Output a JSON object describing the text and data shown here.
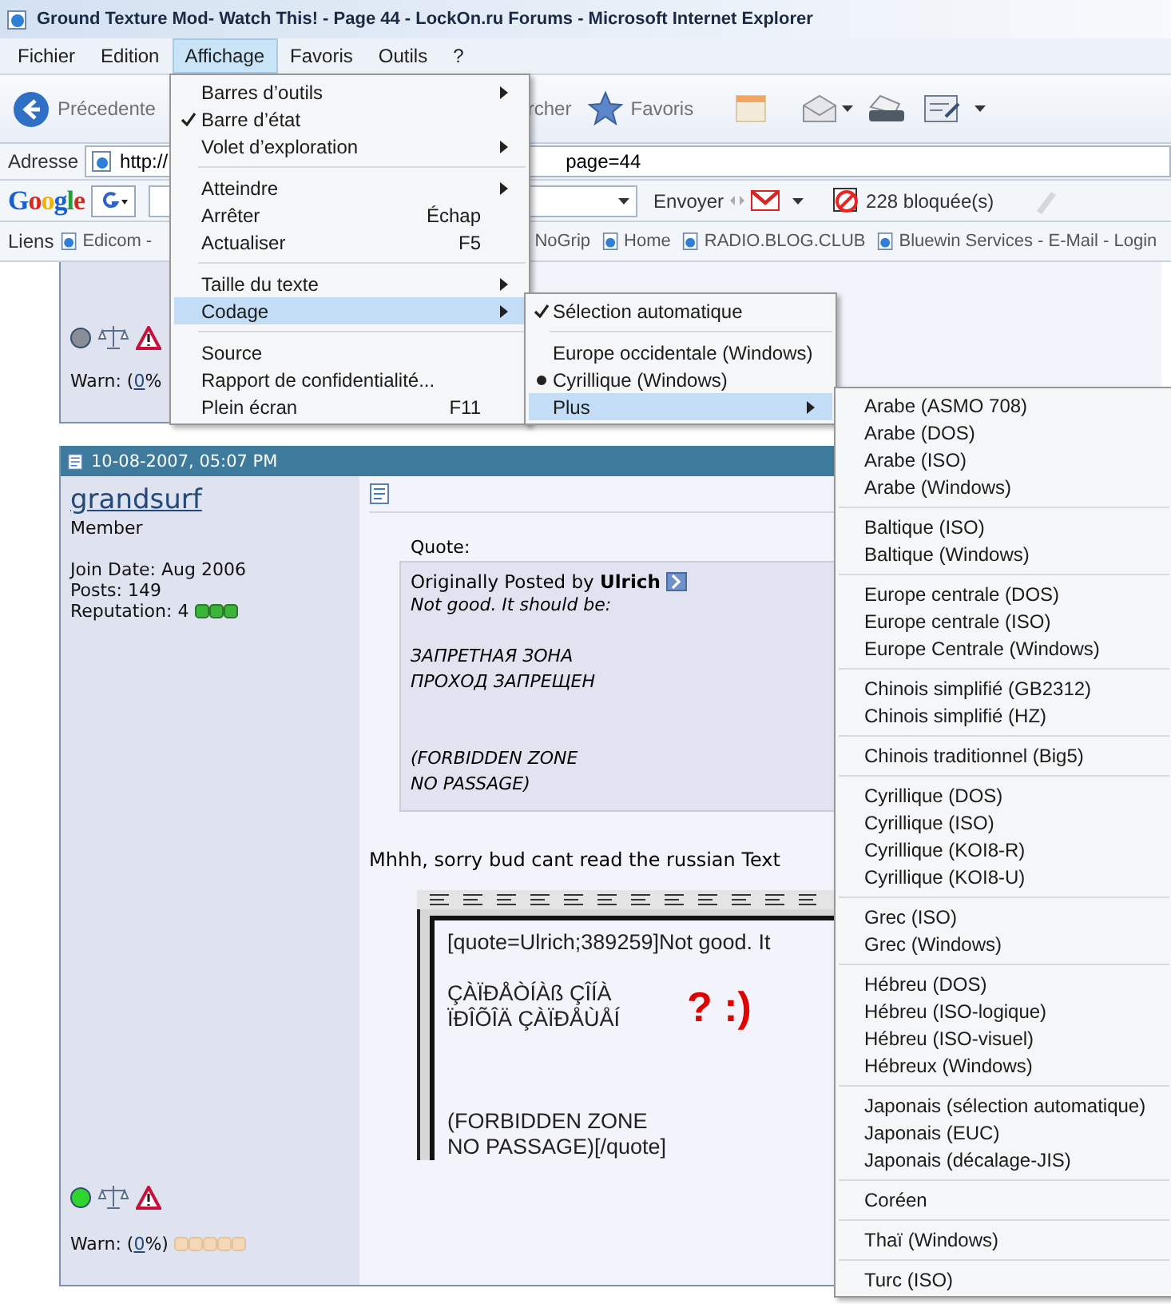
{
  "window": {
    "title": "Ground Texture Mod- Watch This! - Page 44 - LockOn.ru Forums - Microsoft Internet Explorer"
  },
  "menubar": [
    {
      "label": "Fichier",
      "selected": false
    },
    {
      "label": "Edition",
      "selected": false
    },
    {
      "label": "Affichage",
      "selected": true
    },
    {
      "label": "Favoris",
      "selected": false
    },
    {
      "label": "Outils",
      "selected": false
    },
    {
      "label": "?",
      "selected": false
    }
  ],
  "toolbar": {
    "back": "Précedente",
    "search": "rcher",
    "favorites": "Favoris"
  },
  "address": {
    "label": "Adresse",
    "value_start": "http://",
    "value_end": "page=44"
  },
  "google_bar": {
    "logo": "Google",
    "send": "Envoyer",
    "blocked": "228 bloquée(s)"
  },
  "links": {
    "label": "Liens",
    "items": [
      "Edicom -",
      "NoGrip",
      "Home",
      "RADIO.BLOG.CLUB",
      "Bluewin Services - E-Mail - Login"
    ]
  },
  "posts": [
    {
      "kind": "partial",
      "online": false,
      "warn": {
        "before": "Warn: (",
        "link": "0",
        "after": "%"
      }
    },
    {
      "kind": "full",
      "date": "10-08-2007, 05:07 PM",
      "user": "grandsurf",
      "rank": "Member",
      "details": [
        "Join Date: Aug 2006",
        "Posts: 149",
        "Reputation: 4"
      ],
      "quote_label": "Quote:",
      "quote_by": "Originally Posted by **Ulrich**",
      "quote_paragraphs": [
        "Not good. It should be:",
        "ЗАПРЕТНАЯ ЗОНА\nПРОХОД ЗАПРЕЩЕН",
        "(FORBIDDEN ZONE\nNO PASSAGE)"
      ],
      "body": "Mhhh, sorry bud cant read the russian Text",
      "editor_paragraphs": [
        "[quote=Ulrich;389259]Not good. It",
        "ÇÀÏÐÅÒÍÀß ÇÎÍÀ\nÏÐÎÕÎÄ ÇÀÏÐÅÙÅÍ",
        "(FORBIDDEN ZONE\nNO PASSAGE)[/quote]"
      ],
      "editor_note": "? :)",
      "online": true,
      "warn": {
        "before": "Warn: (",
        "link": "0",
        "after": "%)"
      }
    }
  ],
  "view_menu": [
    {
      "kind": "item",
      "label": "Barres d’outils",
      "submenu": true,
      "checked": false,
      "selected": false
    },
    {
      "kind": "item",
      "label": "Barre d’état",
      "submenu": false,
      "checked": true,
      "selected": false
    },
    {
      "kind": "item",
      "label": "Volet d’exploration",
      "submenu": true,
      "checked": false,
      "selected": false
    },
    {
      "kind": "separator"
    },
    {
      "kind": "item",
      "label": "Atteindre",
      "submenu": true,
      "checked": false,
      "selected": false
    },
    {
      "kind": "item",
      "label": "Arrêter",
      "shortcut": "Échap",
      "submenu": false,
      "checked": false,
      "selected": false
    },
    {
      "kind": "item",
      "label": "Actualiser",
      "shortcut": "F5",
      "submenu": false,
      "checked": false,
      "selected": false
    },
    {
      "kind": "separator"
    },
    {
      "kind": "item",
      "label": "Taille du texte",
      "submenu": true,
      "checked": false,
      "selected": false
    },
    {
      "kind": "item",
      "label": "Codage",
      "submenu": true,
      "checked": false,
      "selected": true
    },
    {
      "kind": "separator"
    },
    {
      "kind": "item",
      "label": "Source",
      "submenu": false,
      "checked": false,
      "selected": false
    },
    {
      "kind": "item",
      "label": "Rapport de confidentialité...",
      "submenu": false,
      "checked": false,
      "selected": false
    },
    {
      "kind": "item",
      "label": "Plein écran",
      "shortcut": "F11",
      "submenu": false,
      "checked": false,
      "selected": false
    }
  ],
  "encoding_menu": [
    {
      "kind": "item",
      "label": "Sélection automatique",
      "submenu": false,
      "checked": true,
      "selected": false
    },
    {
      "kind": "separator"
    },
    {
      "kind": "radio",
      "label": "Europe occidentale (Windows)",
      "submenu": false,
      "checked": false,
      "selected": false
    },
    {
      "kind": "radio",
      "label": "Cyrillique (Windows)",
      "submenu": false,
      "checked": true,
      "selected": false
    },
    {
      "kind": "item",
      "label": "Plus",
      "submenu": true,
      "checked": false,
      "selected": true
    }
  ],
  "more_menu": [
    [
      "Arabe (ASMO 708)",
      "Arabe (DOS)",
      "Arabe (ISO)",
      "Arabe (Windows)"
    ],
    [
      "Baltique (ISO)",
      "Baltique (Windows)"
    ],
    [
      "Europe centrale (DOS)",
      "Europe centrale (ISO)",
      "Europe Centrale (Windows)"
    ],
    [
      "Chinois simplifié (GB2312)",
      "Chinois simplifié (HZ)"
    ],
    [
      "Chinois traditionnel (Big5)"
    ],
    [
      "Cyrillique (DOS)",
      "Cyrillique (ISO)",
      "Cyrillique (KOI8-R)",
      "Cyrillique (KOI8-U)"
    ],
    [
      "Grec (ISO)",
      "Grec (Windows)"
    ],
    [
      "Hébreu (DOS)",
      "Hébreu (ISO-logique)",
      "Hébreu (ISO-visuel)",
      "Hébreux (Windows)"
    ],
    [
      "Japonais (sélection automatique)",
      "Japonais (EUC)",
      "Japonais (décalage-JIS)"
    ],
    [
      "Coréen"
    ],
    [
      "Thaï (Windows)"
    ],
    [
      "Turc (ISO)"
    ]
  ]
}
